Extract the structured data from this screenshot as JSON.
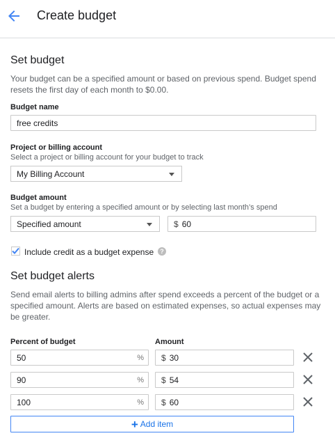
{
  "header": {
    "title": "Create budget",
    "back_icon": "arrow-back-icon",
    "accent": "#4285f4"
  },
  "set_budget": {
    "title": "Set budget",
    "description": "Your budget can be a specified amount or based on previous spend. Budget spend resets the first day of each month to $0.00.",
    "budget_name": {
      "label": "Budget name",
      "value": "free credits"
    },
    "project": {
      "label": "Project or billing account",
      "help": "Select a project or billing account for your budget to track",
      "selected": "My Billing Account"
    },
    "amount": {
      "label": "Budget amount",
      "help": "Set a budget by entering a specified amount or by selecting last month’s spend",
      "type_selected": "Specified amount",
      "currency": "$",
      "value": "60"
    },
    "include_credit": {
      "label": "Include credit as a budget expense",
      "checked": true,
      "help_icon": "?"
    }
  },
  "alerts": {
    "title": "Set budget alerts",
    "description": "Send email alerts to billing admins after spend exceeds a percent of the budget or a specified amount. Alerts are based on estimated expenses, so actual expenses may be greater.",
    "percent_header": "Percent of budget",
    "amount_header": "Amount",
    "percent_suffix": "%",
    "currency": "$",
    "rows": [
      {
        "percent": "50",
        "amount": "30"
      },
      {
        "percent": "90",
        "amount": "54"
      },
      {
        "percent": "100",
        "amount": "60"
      }
    ],
    "add_label": "Add item",
    "add_symbol": "+"
  }
}
